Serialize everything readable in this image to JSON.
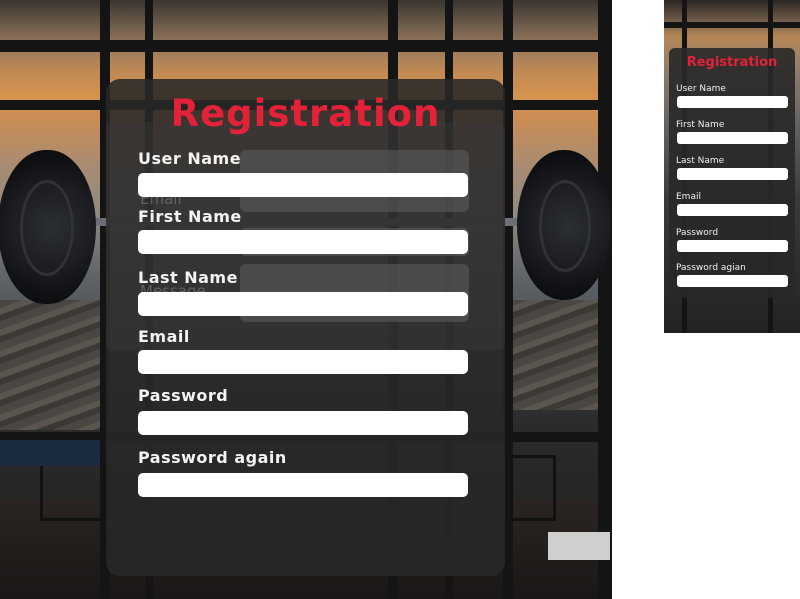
{
  "form": {
    "title": "Registration",
    "fields": [
      {
        "label": "User Name",
        "value": ""
      },
      {
        "label": "First Name",
        "value": ""
      },
      {
        "label": "Last Name",
        "value": ""
      },
      {
        "label": "Email",
        "value": ""
      },
      {
        "label": "Password",
        "value": ""
      },
      {
        "label": "Password again",
        "value": ""
      }
    ],
    "ghost_labels": [
      "Email",
      "Message"
    ]
  },
  "mobile_preview": {
    "title": "Registration",
    "labels": [
      "User Name",
      "First Name",
      "Last Name",
      "Email",
      "Password",
      "Password agian"
    ]
  },
  "colors": {
    "accent": "#e3223a",
    "card": "#282828",
    "input": "#ffffff",
    "label": "#f3f3f3"
  }
}
